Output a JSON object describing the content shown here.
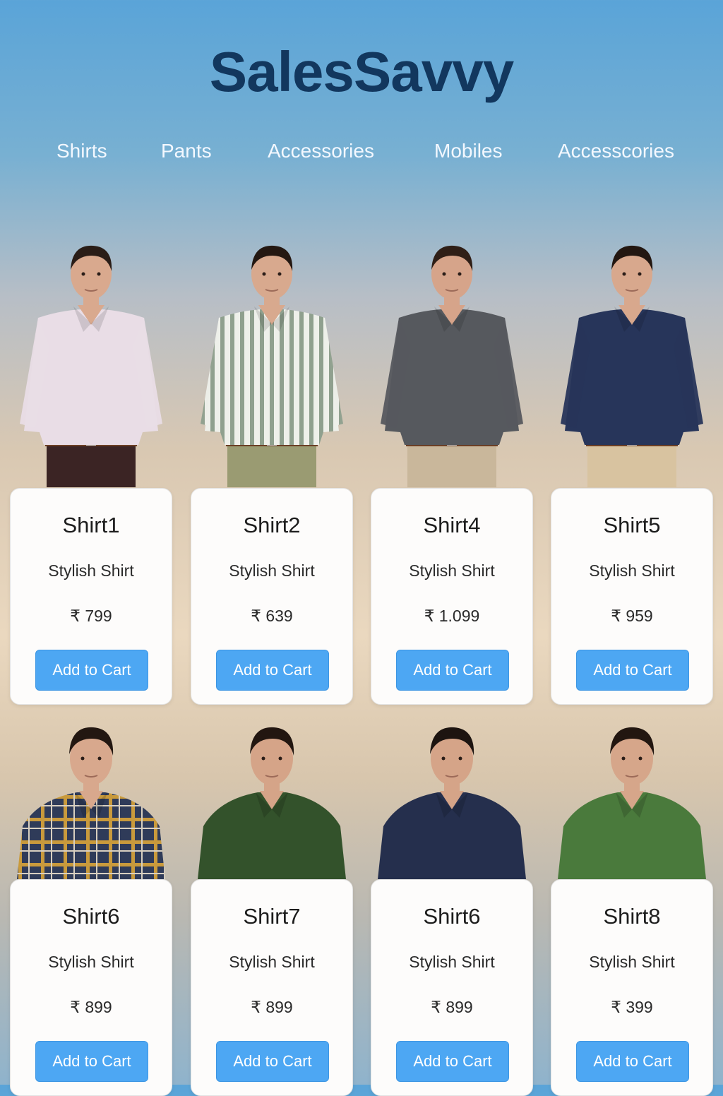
{
  "brand": {
    "name": "SalesSavvy"
  },
  "nav": {
    "items": [
      {
        "label": "Shirts"
      },
      {
        "label": "Pants"
      },
      {
        "label": "Accessories"
      },
      {
        "label": "Mobiles"
      },
      {
        "label": "Accesscories"
      }
    ]
  },
  "products": [
    {
      "name": "Shirt1",
      "description": "Stylish Shirt",
      "price": "₹ 799",
      "button_label": "Add to Cart",
      "shirt_color": "#e9dde6",
      "pants_color": "#3b2424",
      "skin_color": "#d9a98e",
      "hair_color": "#2a1d17",
      "pattern": "plain"
    },
    {
      "name": "Shirt2",
      "description": "Stylish Shirt",
      "price": "₹ 639",
      "button_label": "Add to Cart",
      "shirt_color": "#eef0ea",
      "pants_color": "#9a9b72",
      "skin_color": "#d8a98e",
      "hair_color": "#241812",
      "pattern": "stripes"
    },
    {
      "name": "Shirt4",
      "description": "Stylish Shirt",
      "price": "₹ 1.099",
      "button_label": "Add to Cart",
      "shirt_color": "#56595e",
      "pants_color": "#c9b79b",
      "skin_color": "#d6a48a",
      "hair_color": "#2f1f17",
      "pattern": "plain"
    },
    {
      "name": "Shirt5",
      "description": "Stylish Shirt",
      "price": "₹ 959",
      "button_label": "Add to Cart",
      "shirt_color": "#27355a",
      "pants_color": "#d8c3a0",
      "skin_color": "#d8a88d",
      "hair_color": "#231711",
      "pattern": "plain"
    },
    {
      "name": "Shirt6",
      "description": "Stylish Shirt",
      "price": "₹ 899",
      "button_label": "Add to Cart",
      "shirt_color": "#2f3b59",
      "pants_color": "#2f3b59",
      "skin_color": "#d8a88d",
      "hair_color": "#231711",
      "pattern": "plaid"
    },
    {
      "name": "Shirt7",
      "description": "Stylish Shirt",
      "price": "₹ 899",
      "button_label": "Add to Cart",
      "shirt_color": "#33522b",
      "pants_color": "#33522b",
      "skin_color": "#d5a488",
      "hair_color": "#221610",
      "pattern": "plain"
    },
    {
      "name": "Shirt6",
      "description": "Stylish Shirt",
      "price": "₹ 899",
      "button_label": "Add to Cart",
      "shirt_color": "#252f4d",
      "pants_color": "#252f4d",
      "skin_color": "#d5a488",
      "hair_color": "#1d1410",
      "pattern": "plain"
    },
    {
      "name": "Shirt8",
      "description": "Stylish Shirt",
      "price": "₹ 399",
      "button_label": "Add to Cart",
      "shirt_color": "#4a7a3c",
      "pants_color": "#4a7a3c",
      "skin_color": "#d6a68a",
      "hair_color": "#221610",
      "pattern": "plain"
    }
  ]
}
